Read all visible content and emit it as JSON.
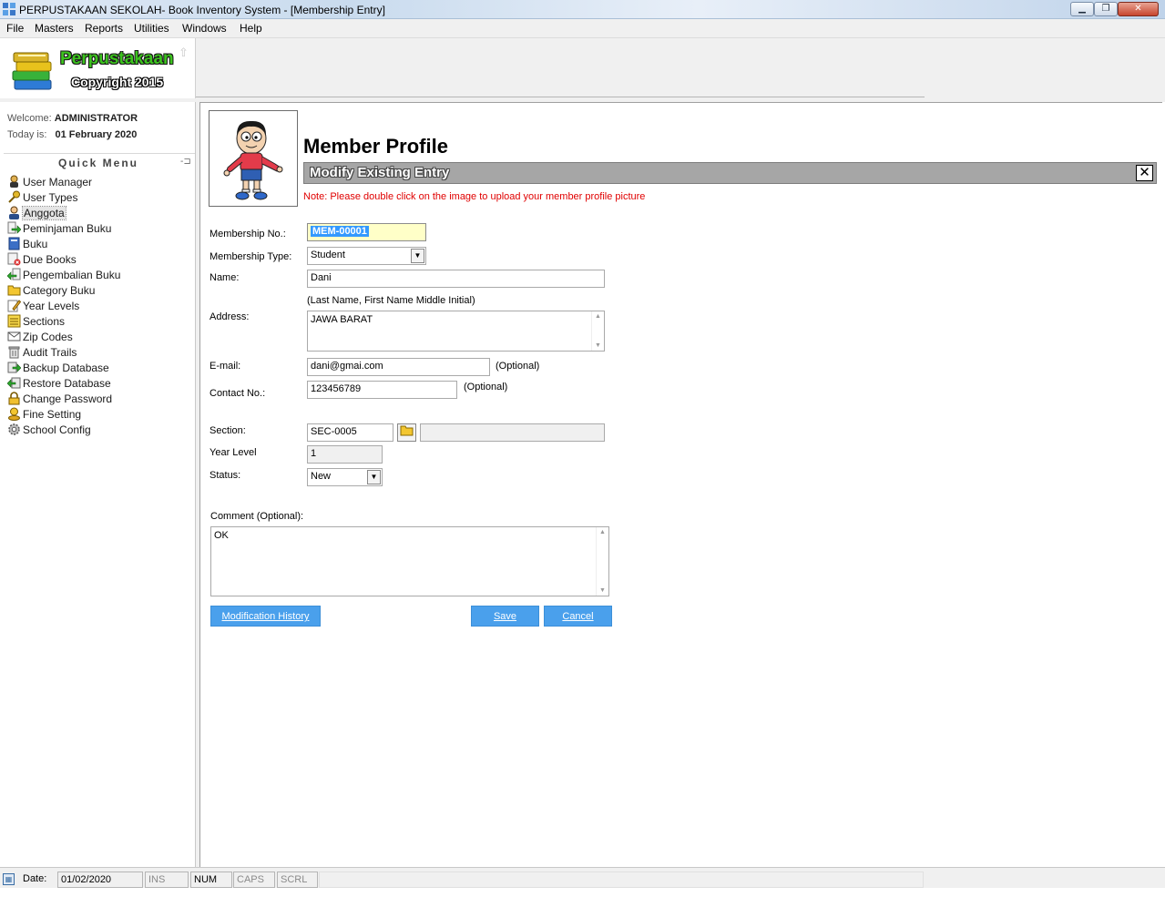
{
  "window": {
    "title": "PERPUSTAKAAN SEKOLAH- Book Inventory System  - [Membership Entry]",
    "minimize": "▁",
    "maximize": "❐",
    "close": "✕"
  },
  "menu": [
    "File",
    "Masters",
    "Reports",
    "Utilities",
    "Windows",
    "Help"
  ],
  "logo": {
    "title": "Perpustakaan",
    "copyright": "Copyright 2015"
  },
  "sidebar": {
    "welcome_label": "Welcome:",
    "welcome_user": "ADMINISTRATOR",
    "today_label": "Today is:",
    "today_value": "01 February 2020",
    "quick_menu_title": "Quick Menu",
    "items": [
      {
        "label": "User Manager",
        "icon": "user-icon"
      },
      {
        "label": "User Types",
        "icon": "key-icon"
      },
      {
        "label": "Anggota",
        "icon": "member-icon"
      },
      {
        "label": "Peminjaman Buku",
        "icon": "arrow-right-icon"
      },
      {
        "label": "Buku",
        "icon": "book-icon"
      },
      {
        "label": "Due Books",
        "icon": "due-book-icon"
      },
      {
        "label": "Pengembalian Buku",
        "icon": "arrow-left-icon"
      },
      {
        "label": "Category Buku",
        "icon": "folder-icon"
      },
      {
        "label": "Year Levels",
        "icon": "pencil-icon"
      },
      {
        "label": "Sections",
        "icon": "list-icon"
      },
      {
        "label": "Zip Codes",
        "icon": "envelope-icon"
      },
      {
        "label": "Audit Trails",
        "icon": "trash-icon"
      },
      {
        "label": "Backup Database",
        "icon": "backup-icon"
      },
      {
        "label": "Restore Database",
        "icon": "restore-icon"
      },
      {
        "label": "Change Password",
        "icon": "lock-icon"
      },
      {
        "label": "Fine Setting",
        "icon": "coin-icon"
      },
      {
        "label": "School Config",
        "icon": "gear-icon"
      }
    ]
  },
  "form": {
    "title": "Member Profile",
    "subtitle": "Modify Existing Entry",
    "close": "✕",
    "note": "Note: Please double click on the image to upload your member profile picture",
    "membership_no_label": "Membership No.:",
    "membership_no": "MEM-00001",
    "membership_type_label": "Membership Type:",
    "membership_type": "Student",
    "name_label": "Name:",
    "name": "Dani",
    "name_hint": "(Last Name, First Name Middle Initial)",
    "address_label": "Address:",
    "address": "JAWA BARAT",
    "email_label": "E-mail:",
    "email": "dani@gmai.com",
    "email_hint": "(Optional)",
    "contact_label": "Contact No.:",
    "contact": "123456789",
    "contact_hint": "(Optional)",
    "section_label": "Section:",
    "section": "SEC-0005",
    "section_name": "",
    "year_level_label": "Year Level",
    "year_level": "1",
    "status_label": "Status:",
    "status": "New",
    "comment_label": "Comment (Optional):",
    "comment": "OK",
    "btn_history": "Modification History",
    "btn_save": "Save",
    "btn_cancel": "Cancel"
  },
  "statusbar": {
    "date_label": "Date:",
    "date": "01/02/2020",
    "ins": "INS",
    "num": "NUM",
    "caps": "CAPS",
    "scrl": "SCRL"
  },
  "colors": {
    "button_blue": "#4aa0ec",
    "note_red": "#e00000",
    "subbar_gray": "#a6a6a6",
    "logo_green": "#3cc31e"
  }
}
